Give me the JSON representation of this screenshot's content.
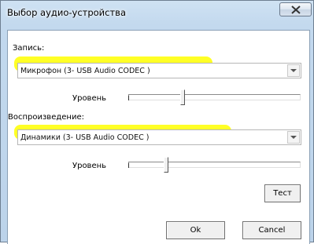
{
  "window": {
    "title": "Выбор аудио-устройства"
  },
  "recording": {
    "section_label": "Запись:",
    "device_value": "Микрофон (3- USB Audio CODEC )",
    "level_label": "Уровень",
    "level_fraction": 0.31
  },
  "playback": {
    "section_label": "Воспроизведение:",
    "device_value": "Динамики (3- USB Audio CODEC )",
    "level_label": "Уровень",
    "level_fraction": 0.21
  },
  "buttons": {
    "test": "Тест",
    "ok": "Ok",
    "cancel": "Cancel"
  },
  "colors": {
    "highlight": "#ffff00",
    "title_bar": "#c3d9ee"
  }
}
